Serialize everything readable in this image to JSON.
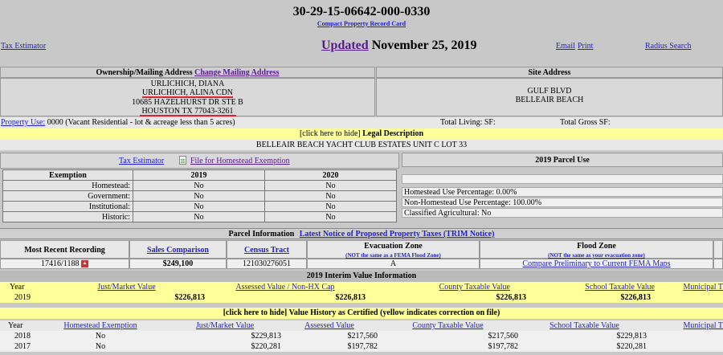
{
  "header": {
    "parcel_number": "30-29-15-06642-000-0330",
    "compact_link": "Compact Property Record Card",
    "tax_estimator": "Tax Estimator",
    "updated_word": "Updated",
    "updated_date": "November 25, 2019",
    "email": "Email",
    "print": "Print",
    "radius_search": "Radius Search"
  },
  "ownership": {
    "heading": "Ownership/Mailing Address",
    "change_link": "Change Mailing Address",
    "lines": [
      "URLICHICH, DIANA",
      "URLICHICH, ALINA CDN",
      "10685 HAZELHURST DR STE B",
      "HOUSTON TX 77043-3261"
    ]
  },
  "site": {
    "heading": "Site Address",
    "lines": [
      "GULF BLVD",
      "BELLEAIR BEACH"
    ]
  },
  "property_use": {
    "link": "Property Use:",
    "value": "0000 (Vacant Residential - lot & acreage less than 5 acres)",
    "total_living": "Total Living: SF:",
    "total_gross": "Total Gross SF:"
  },
  "legal": {
    "toggle": "[click here to hide]",
    "label": "Legal Description",
    "text": "BELLEAIR BEACH YACHT CLUB ESTATES UNIT C LOT 33"
  },
  "exemptions": {
    "tax_estimator": "Tax Estimator",
    "homestead_link": "File for Homestead Exemption",
    "headers": [
      "Exemption",
      "2019",
      "2020"
    ],
    "rows": [
      [
        "Homestead:",
        "No",
        "No"
      ],
      [
        "Government:",
        "No",
        "No"
      ],
      [
        "Institutional:",
        "No",
        "No"
      ],
      [
        "Historic:",
        "No",
        "No"
      ]
    ]
  },
  "parcel_use": {
    "heading": "2019 Parcel Use",
    "rows": [
      "Homestead Use Percentage:  0.00%",
      "Non-Homestead Use Percentage:  100.00%",
      "Classified Agricultural: No"
    ]
  },
  "parcel_info": {
    "label": "Parcel Information",
    "trim_link": "Latest Notice of Proposed Property Taxes (TRIM Notice)",
    "most_recent": "Most Recent Recording",
    "sales_comparison": "Sales Comparison",
    "census_tract": "Census Tract",
    "evac_zone": "Evacuation Zone",
    "evac_note": "(NOT the same as a FEMA Flood Zone)",
    "flood_zone": "Flood Zone",
    "flood_note": "(NOT the same as your evacuation zone)",
    "recording_value": "17416/1188",
    "sales_value": "$249,100",
    "census_value": "121030276051",
    "evac_value": "A",
    "flood_link": "Compare Preliminary to Current FEMA Maps"
  },
  "interim": {
    "title": "2019 Interim Value Information",
    "headers": [
      "Year",
      "Just/Market Value",
      "Assessed Value / Non-HX Cap",
      "County Taxable Value",
      "School Taxable Value",
      "Municipal T"
    ],
    "row": [
      "2019",
      "$226,813",
      "$226,813",
      "$226,813",
      "$226,813"
    ]
  },
  "history": {
    "toggle": "[click here to hide]",
    "title": "Value History as Certified (yellow indicates correction on file)",
    "headers": [
      "Year",
      "Homestead Exemption",
      "Just/Market Value",
      "Assessed Value",
      "County Taxable Value",
      "School Taxable Value",
      "Municipal T"
    ],
    "rows": [
      [
        "2018",
        "No",
        "$229,813",
        "$217,560",
        "$217,560",
        "$229,813"
      ],
      [
        "2017",
        "No",
        "$220,281",
        "$197,782",
        "$197,782",
        "$220,281"
      ]
    ]
  },
  "icons": {
    "pdf": "pdf-icon",
    "document": "document-icon"
  }
}
